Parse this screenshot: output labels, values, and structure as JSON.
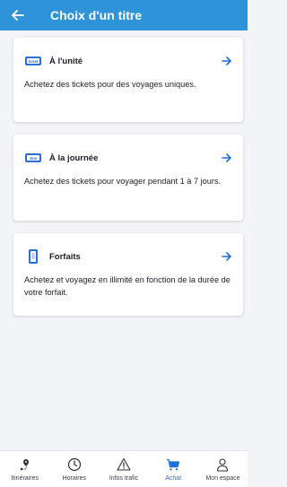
{
  "header": {
    "title": "Choix d'un titre",
    "back_icon": "arrow-left-icon",
    "background": "#2e93d9"
  },
  "cards": [
    {
      "icon": "ticket-icon",
      "icon_text": "ticket",
      "title": "À l'unité",
      "description": "Achetez des tickets pour des voyages uniques.",
      "arrow_icon": "arrow-right-icon"
    },
    {
      "icon": "day-ticket-icon",
      "icon_text": "Jour",
      "title": "À la journée",
      "description": "Achetez des tickets pour voyager pendant 1 à 7 jours.",
      "arrow_icon": "arrow-right-icon"
    },
    {
      "icon": "pass-card-icon",
      "icon_text": "",
      "title": "Forfaits",
      "description": "Achetez et voyagez en illimité en fonction de la durée de votre forfait.",
      "arrow_icon": "arrow-right-icon"
    }
  ],
  "bottom_nav": {
    "active": "Achat",
    "items": [
      {
        "label": "Itinéraires",
        "icon": "route-pin-icon"
      },
      {
        "label": "Horaires",
        "icon": "clock-icon"
      },
      {
        "label": "Infos trafic",
        "icon": "warning-icon"
      },
      {
        "label": "Achat",
        "icon": "cart-icon"
      },
      {
        "label": "Mon espace",
        "icon": "user-icon"
      }
    ]
  },
  "colors": {
    "accent": "#1e6fd6",
    "header": "#2e93d9",
    "background": "#f2f4f7"
  }
}
